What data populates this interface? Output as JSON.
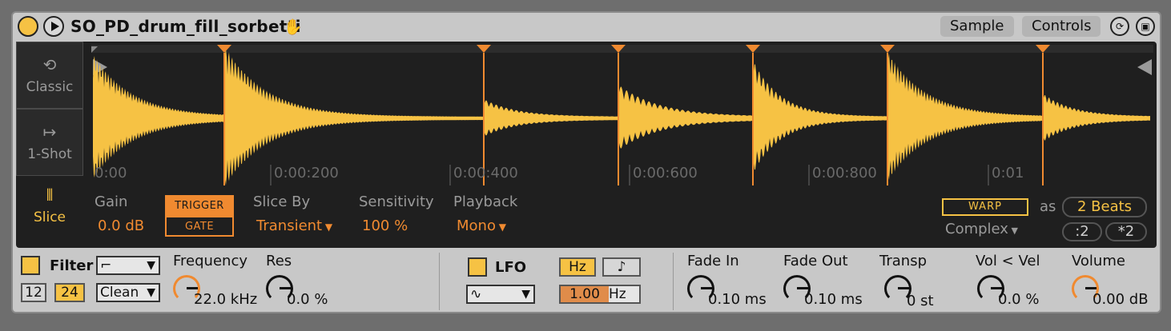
{
  "title_bar": {
    "device_name": "SO_PD_drum_fill_sorbetti",
    "tabs": [
      "Sample",
      "Controls"
    ],
    "icons": [
      "power-icon",
      "play-icon",
      "hand-icon",
      "hot-swap-icon",
      "save-icon"
    ]
  },
  "modes": {
    "classic": "Classic",
    "one_shot": "1-Shot",
    "slice": "Slice"
  },
  "waveform": {
    "time_labels": [
      "0:00:200",
      "0:00:400",
      "0:00:600",
      "0:00:800",
      "0:01"
    ],
    "partial_start_label": "0:00",
    "accent_color": "#f6c244",
    "marker_color": "#f08a30"
  },
  "sample_params": {
    "gain_label": "Gain",
    "gain_value": "0.0 dB",
    "trigger_label": "TRIGGER",
    "gate_label": "GATE",
    "slice_by_label": "Slice By",
    "slice_by_value": "Transient",
    "sensitivity_label": "Sensitivity",
    "sensitivity_value": "100 %",
    "playback_label": "Playback",
    "playback_value": "Mono",
    "warp_label": "WARP",
    "as_label": "as",
    "beats_value": "2 Beats",
    "warp_mode": "Complex",
    "half_label": ":2",
    "double_label": "*2"
  },
  "filter": {
    "label": "Filter",
    "slope_12": "12",
    "slope_24": "24",
    "type": "Clean",
    "frequency_label": "Frequency",
    "frequency_value": "22.0 kHz",
    "res_label": "Res",
    "res_value": "0.0 %"
  },
  "lfo": {
    "label": "LFO",
    "hz_label": "Hz",
    "note_label": "♪",
    "rate_value": "1.00",
    "rate_unit": "Hz"
  },
  "envelope": {
    "fade_in_label": "Fade In",
    "fade_in_value": "0.10 ms",
    "fade_out_label": "Fade Out",
    "fade_out_value": "0.10 ms",
    "transp_label": "Transp",
    "transp_value": "0 st",
    "vol_vel_label": "Vol < Vel",
    "vol_vel_value": "0.0 %",
    "volume_label": "Volume",
    "volume_value": "0.00 dB"
  }
}
